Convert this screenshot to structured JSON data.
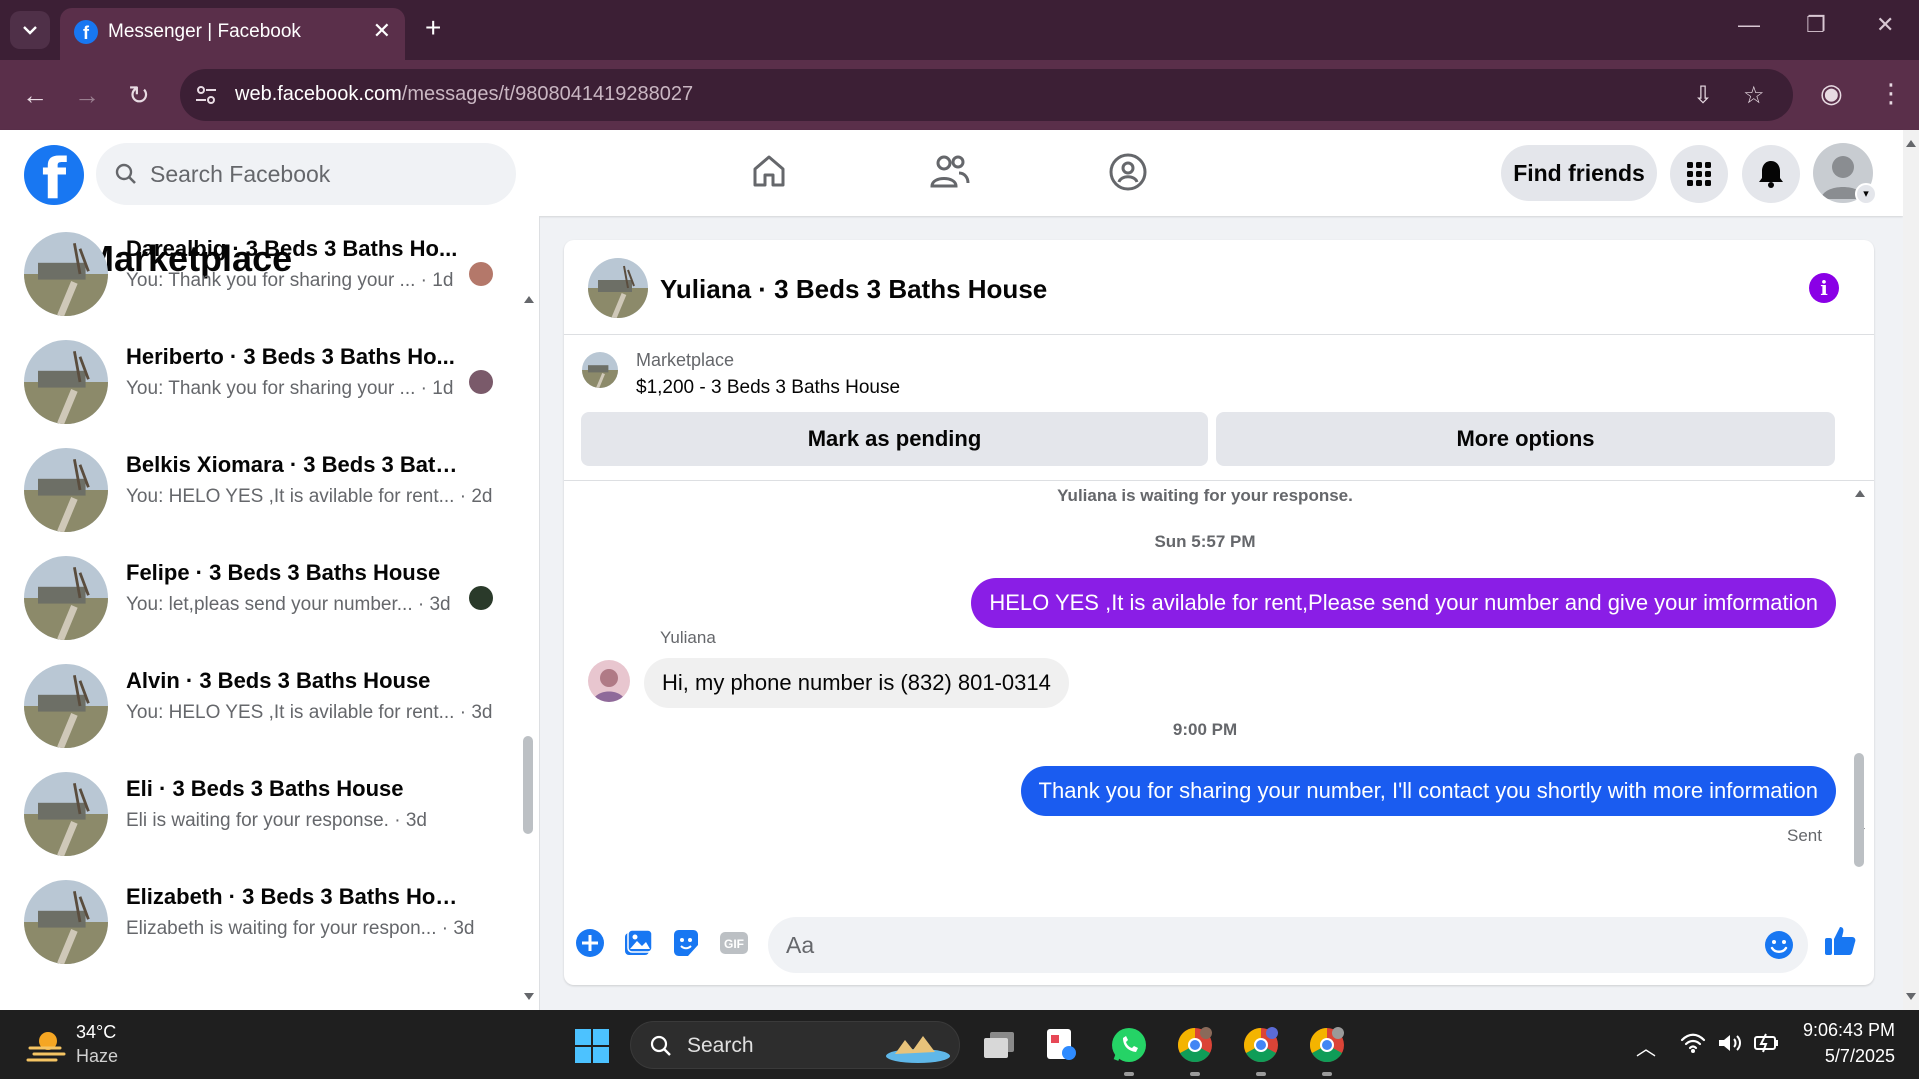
{
  "browser": {
    "tab_title": "Messenger | Facebook",
    "url_host": "web.facebook.com",
    "url_path": "/messages/t/9808041419288027",
    "new_tab_icon": "plus-icon",
    "minimize_icon": "minimize-icon",
    "restore_icon": "restore-icon",
    "close_icon": "close-icon"
  },
  "facebook": {
    "logo_letter": "f",
    "search_placeholder": "Search Facebook",
    "find_friends": "Find friends",
    "brand_color": "#1877f2"
  },
  "sidebar": {
    "title": "Marketplace",
    "conversations": [
      {
        "name": "Darealbig · 3 Beds 3 Baths Ho...",
        "snippet": "You: Thank you for sharing your ... · 1d"
      },
      {
        "name": "Heriberto · 3 Beds 3 Baths Ho...",
        "snippet": "You: Thank you for sharing your ... · 1d"
      },
      {
        "name": "Belkis Xiomara · 3 Beds 3 Baths ...",
        "snippet": "You: HELO YES ,It is avilable for rent... · 2d"
      },
      {
        "name": "Felipe · 3 Beds 3 Baths House",
        "snippet": "You: let,pleas send your number... · 3d"
      },
      {
        "name": "Alvin · 3 Beds 3 Baths House",
        "snippet": "You: HELO YES ,It is avilable for rent... · 3d"
      },
      {
        "name": "Eli · 3 Beds 3 Baths House",
        "snippet": "Eli is waiting for your response. · 3d"
      },
      {
        "name": "Elizabeth · 3 Beds 3 Baths House",
        "snippet": "Elizabeth is waiting for your respon... · 3d"
      }
    ]
  },
  "chat": {
    "header_name": "Yuliana · 3 Beds 3 Baths House",
    "info_icon": "i",
    "listing_category": "Marketplace",
    "listing_title": "$1,200 - 3 Beds 3 Baths House",
    "mark_pending": "Mark as pending",
    "more_options": "More options",
    "waiting_note": "Yuliana is waiting for your response.",
    "time_1": "Sun 5:57 PM",
    "out_msg_1": "HELO YES ,It is avilable for rent,Please send your number and give your imformation",
    "out_msg_1_color": "#8a1ee6",
    "sender_name": "Yuliana",
    "in_msg_1": "Hi, my phone number is (832) 801-0314",
    "time_2": "9:00 PM",
    "out_msg_2": "Thank you for sharing your number, I'll contact you shortly with more information",
    "out_msg_2_color": "#1a5cf0",
    "sent_status": "Sent",
    "composer_placeholder": "Aa"
  },
  "taskbar": {
    "weather_temp": "34°C",
    "weather_desc": "Haze",
    "search_text": "Search",
    "clock_time": "9:06:43 PM",
    "clock_date": "5/7/2025"
  }
}
